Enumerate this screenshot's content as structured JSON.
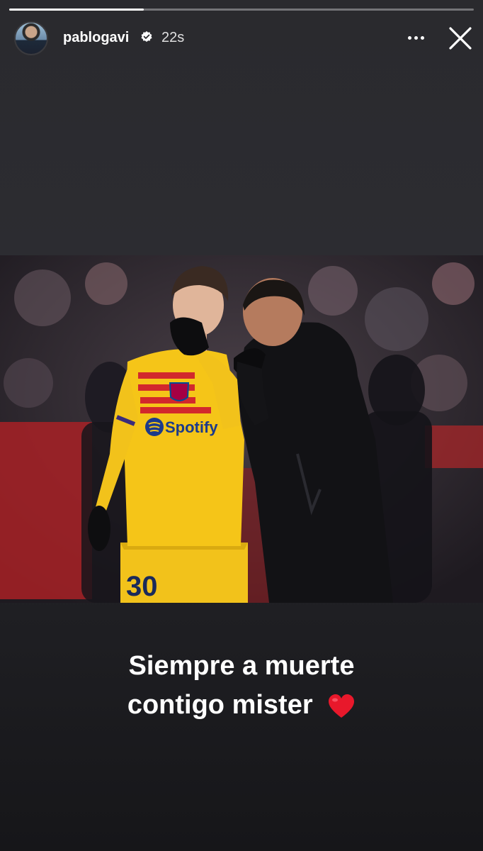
{
  "story": {
    "progress": 0.29,
    "user": {
      "username": "pablogavi",
      "verified": true,
      "time_ago": "22s"
    },
    "photo": {
      "jersey_number": "30",
      "sponsor": "Spotify"
    },
    "caption": {
      "line1": "Siempre a muerte",
      "line2": "contigo mister"
    },
    "icons": [
      "verified-badge-icon",
      "more-options-icon",
      "close-icon",
      "heart-icon"
    ],
    "colors": {
      "jersey_yellow": "#f5c518",
      "stripe_red": "#d2282c",
      "background": "#2b2b2f"
    }
  }
}
